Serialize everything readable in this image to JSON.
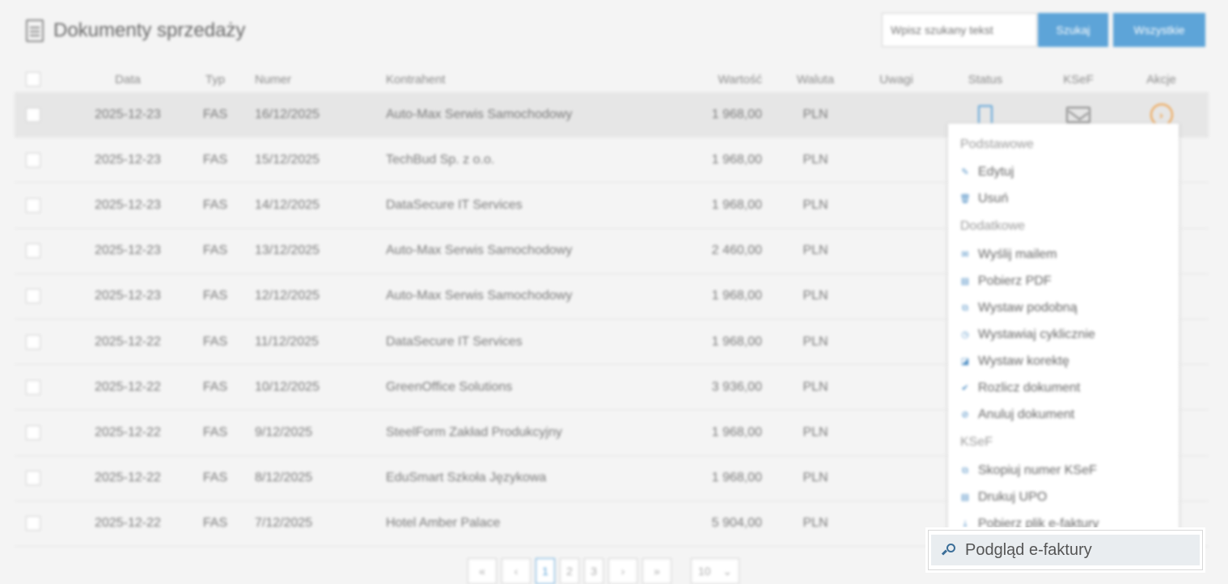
{
  "header": {
    "title": "Dokumenty sprzedaży",
    "search_placeholder": "Wpisz szukany tekst",
    "search_button": "Szukaj",
    "all_button": "Wszystkie"
  },
  "table": {
    "columns": {
      "data": "Data",
      "typ": "Typ",
      "numer": "Numer",
      "kontrahent": "Kontrahent",
      "wartosc": "Wartość",
      "waluta": "Waluta",
      "uwagi": "Uwagi",
      "status": "Status",
      "ksef": "KSeF",
      "akcje": "Akcje"
    },
    "rows": [
      {
        "data": "2025-12-23",
        "typ": "FAS",
        "numer": "16/12/2025",
        "kontrahent": "Auto-Max Serwis Samochodowy",
        "wartosc": "1 968,00",
        "waluta": "PLN"
      },
      {
        "data": "2025-12-23",
        "typ": "FAS",
        "numer": "15/12/2025",
        "kontrahent": "TechBud Sp. z o.o.",
        "wartosc": "1 968,00",
        "waluta": "PLN"
      },
      {
        "data": "2025-12-23",
        "typ": "FAS",
        "numer": "14/12/2025",
        "kontrahent": "DataSecure IT Services",
        "wartosc": "1 968,00",
        "waluta": "PLN"
      },
      {
        "data": "2025-12-23",
        "typ": "FAS",
        "numer": "13/12/2025",
        "kontrahent": "Auto-Max Serwis Samochodowy",
        "wartosc": "2 460,00",
        "waluta": "PLN"
      },
      {
        "data": "2025-12-23",
        "typ": "FAS",
        "numer": "12/12/2025",
        "kontrahent": "Auto-Max Serwis Samochodowy",
        "wartosc": "1 968,00",
        "waluta": "PLN"
      },
      {
        "data": "2025-12-22",
        "typ": "FAS",
        "numer": "11/12/2025",
        "kontrahent": "DataSecure IT Services",
        "wartosc": "1 968,00",
        "waluta": "PLN"
      },
      {
        "data": "2025-12-22",
        "typ": "FAS",
        "numer": "10/12/2025",
        "kontrahent": "GreenOffice Solutions",
        "wartosc": "3 936,00",
        "waluta": "PLN"
      },
      {
        "data": "2025-12-22",
        "typ": "FAS",
        "numer": "9/12/2025",
        "kontrahent": "SteelForm Zakład Produkcyjny",
        "wartosc": "1 968,00",
        "waluta": "PLN"
      },
      {
        "data": "2025-12-22",
        "typ": "FAS",
        "numer": "8/12/2025",
        "kontrahent": "EduSmart Szkoła Językowa",
        "wartosc": "1 968,00",
        "waluta": "PLN"
      },
      {
        "data": "2025-12-22",
        "typ": "FAS",
        "numer": "7/12/2025",
        "kontrahent": "Hotel Amber Palace",
        "wartosc": "5 904,00",
        "waluta": "PLN"
      }
    ]
  },
  "menu": {
    "sections": {
      "podstawowe": "Podstawowe",
      "dodatkowe": "Dodatkowe",
      "ksef": "KSeF"
    },
    "items": {
      "edytuj": "Edytuj",
      "usun": "Usuń",
      "wyslij": "Wyślij mailem",
      "pdf": "Pobierz PDF",
      "podobna": "Wystaw podobną",
      "cyklicznie": "Wystawiaj cyklicznie",
      "korekta": "Wystaw korektę",
      "rozlicz": "Rozlicz dokument",
      "anuluj": "Anuluj dokument",
      "skopiuj": "Skopiuj numer KSeF",
      "upo": "Drukuj UPO",
      "pobierz_plik": "Pobierz plik e-faktury",
      "podglad": "Podgląd e-faktury"
    }
  },
  "pager": {
    "pages": [
      "1",
      "2",
      "3"
    ],
    "active_page": "1",
    "page_size": "10"
  },
  "colors": {
    "accent": "#5da4d8",
    "action": "#f0a046",
    "background": "#f4f4f4"
  }
}
